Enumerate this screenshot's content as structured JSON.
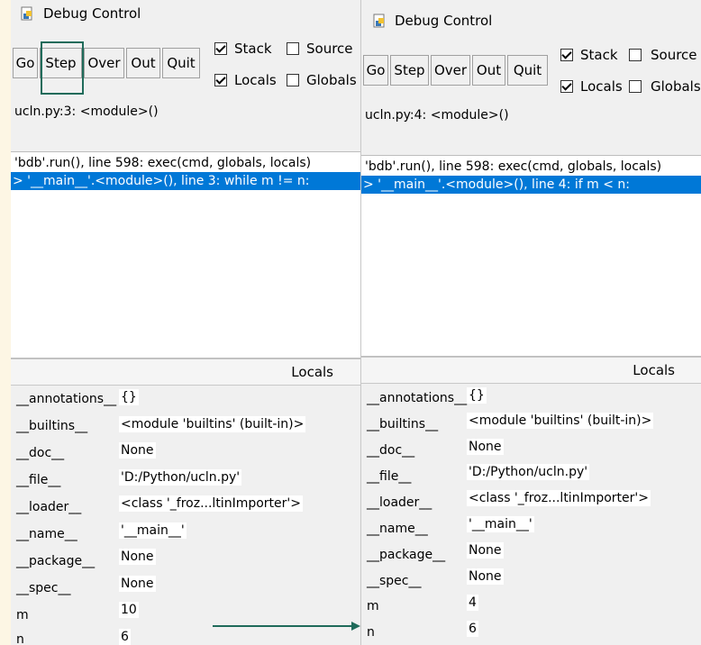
{
  "left": {
    "title": "Debug Control",
    "buttons": {
      "go": "Go",
      "step": "Step",
      "over": "Over",
      "out": "Out",
      "quit": "Quit"
    },
    "checks": {
      "stack": {
        "label": "Stack",
        "checked": true
      },
      "source": {
        "label": "Source",
        "checked": false
      },
      "locals": {
        "label": "Locals",
        "checked": true
      },
      "globals": {
        "label": "Globals",
        "checked": false
      }
    },
    "status": "ucln.py:3: <module>()",
    "stack": [
      "'bdb'.run(), line 598: exec(cmd, globals, locals)",
      "> '__main__'.<module>(), line 3: while m != n:"
    ],
    "locals_title": "Locals",
    "vars": [
      {
        "name": "__annotations__",
        "value": "{}"
      },
      {
        "name": "__builtins__",
        "value": "<module 'builtins' (built-in)>"
      },
      {
        "name": "__doc__",
        "value": "None"
      },
      {
        "name": "__file__",
        "value": "'D:/Python/ucln.py'"
      },
      {
        "name": "__loader__",
        "value": "<class '_froz...ltinImporter'>"
      },
      {
        "name": "__name__",
        "value": "'__main__'"
      },
      {
        "name": "__package__",
        "value": "None"
      },
      {
        "name": "__spec__",
        "value": "None"
      },
      {
        "name": "m",
        "value": "10"
      },
      {
        "name": "n",
        "value": "6"
      }
    ]
  },
  "right": {
    "title": "Debug Control",
    "buttons": {
      "go": "Go",
      "step": "Step",
      "over": "Over",
      "out": "Out",
      "quit": "Quit"
    },
    "checks": {
      "stack": {
        "label": "Stack",
        "checked": true
      },
      "source": {
        "label": "Source",
        "checked": false
      },
      "locals": {
        "label": "Locals",
        "checked": true
      },
      "globals": {
        "label": "Globals",
        "checked": false
      }
    },
    "status": "ucln.py:4: <module>()",
    "stack": [
      "'bdb'.run(), line 598: exec(cmd, globals, locals)",
      "> '__main__'.<module>(), line 4: if m < n:"
    ],
    "locals_title": "Locals",
    "vars": [
      {
        "name": "__annotations__",
        "value": "{}"
      },
      {
        "name": "__builtins__",
        "value": "<module 'builtins' (built-in)>"
      },
      {
        "name": "__doc__",
        "value": "None"
      },
      {
        "name": "__file__",
        "value": "'D:/Python/ucln.py'"
      },
      {
        "name": "__loader__",
        "value": "<class '_froz...ltinImporter'>"
      },
      {
        "name": "__name__",
        "value": "'__main__'"
      },
      {
        "name": "__package__",
        "value": "None"
      },
      {
        "name": "__spec__",
        "value": "None"
      },
      {
        "name": "m",
        "value": "4"
      },
      {
        "name": "n",
        "value": "6"
      }
    ]
  },
  "colors": {
    "selection": "#0078d7",
    "focus_ring": "#1f6b5a",
    "annotation_arrow": "#1f6b5a"
  }
}
